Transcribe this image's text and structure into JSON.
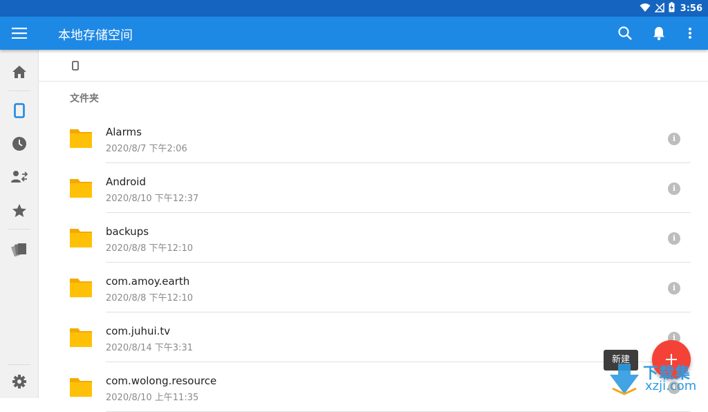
{
  "status_bar": {
    "time": "3:56"
  },
  "app_bar": {
    "title": "本地存储空间",
    "icons": [
      "menu-icon",
      "search-icon",
      "bell-icon",
      "more-vert-icon"
    ]
  },
  "sidebar": {
    "items": [
      "home-icon",
      "phone-icon",
      "clock-icon",
      "transfer-icon",
      "star-icon",
      "cards-icon"
    ],
    "bottom": "settings-icon"
  },
  "section_label": "文件夹",
  "folders": [
    {
      "name": "Alarms",
      "date": "2020/8/7 下午2:06"
    },
    {
      "name": "Android",
      "date": "2020/8/10 下午12:37"
    },
    {
      "name": "backups",
      "date": "2020/8/8 下午12:10"
    },
    {
      "name": "com.amoy.earth",
      "date": "2020/8/8 下午12:10"
    },
    {
      "name": "com.juhui.tv",
      "date": "2020/8/14 下午3:31"
    },
    {
      "name": "com.wolong.resource",
      "date": "2020/8/10 上午11:35"
    }
  ],
  "fab": {
    "tooltip": "新建"
  },
  "watermark": {
    "text_top": "下载集",
    "text_bottom": "xzji.com"
  },
  "colors": {
    "status_bar": "#1565c0",
    "app_bar": "#1e88e5",
    "fab": "#f44336",
    "folder": "#ffc107",
    "accent": "#1e88e5"
  }
}
